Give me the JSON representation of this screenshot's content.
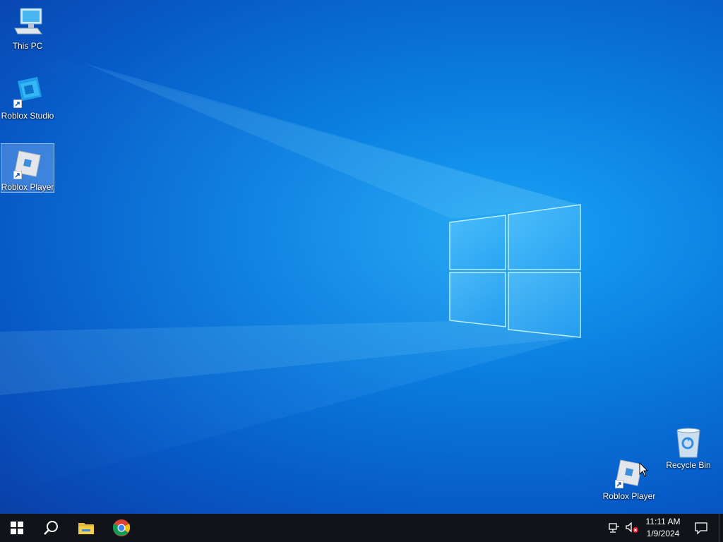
{
  "desktop": {
    "icons": [
      {
        "label": "This PC",
        "icon": "this-pc-icon"
      },
      {
        "label": "Roblox Studio",
        "icon": "roblox-studio-icon"
      },
      {
        "label": "Roblox Player",
        "icon": "roblox-player-icon"
      },
      {
        "label": "Recycle Bin",
        "icon": "recycle-bin-icon"
      },
      {
        "label": "Roblox Player",
        "icon": "roblox-player-icon"
      }
    ],
    "selected_index": 2
  },
  "taskbar": {
    "items": [
      {
        "icon": "windows-start-icon"
      },
      {
        "icon": "search-icon"
      },
      {
        "icon": "file-explorer-icon"
      },
      {
        "icon": "chrome-icon"
      }
    ],
    "tray": {
      "network_icon": "network-icon",
      "volume_icon": "volume-muted-icon",
      "time": "11:11 AM",
      "date": "1/9/2024",
      "notification_icon": "notification-icon"
    }
  },
  "colors": {
    "taskbar_bg": "#101418",
    "desktop_accent": "#0a7fe0",
    "chrome_red": "#db4437",
    "chrome_yellow": "#f4c20d",
    "chrome_green": "#0f9d58",
    "chrome_blue": "#4285f4"
  }
}
